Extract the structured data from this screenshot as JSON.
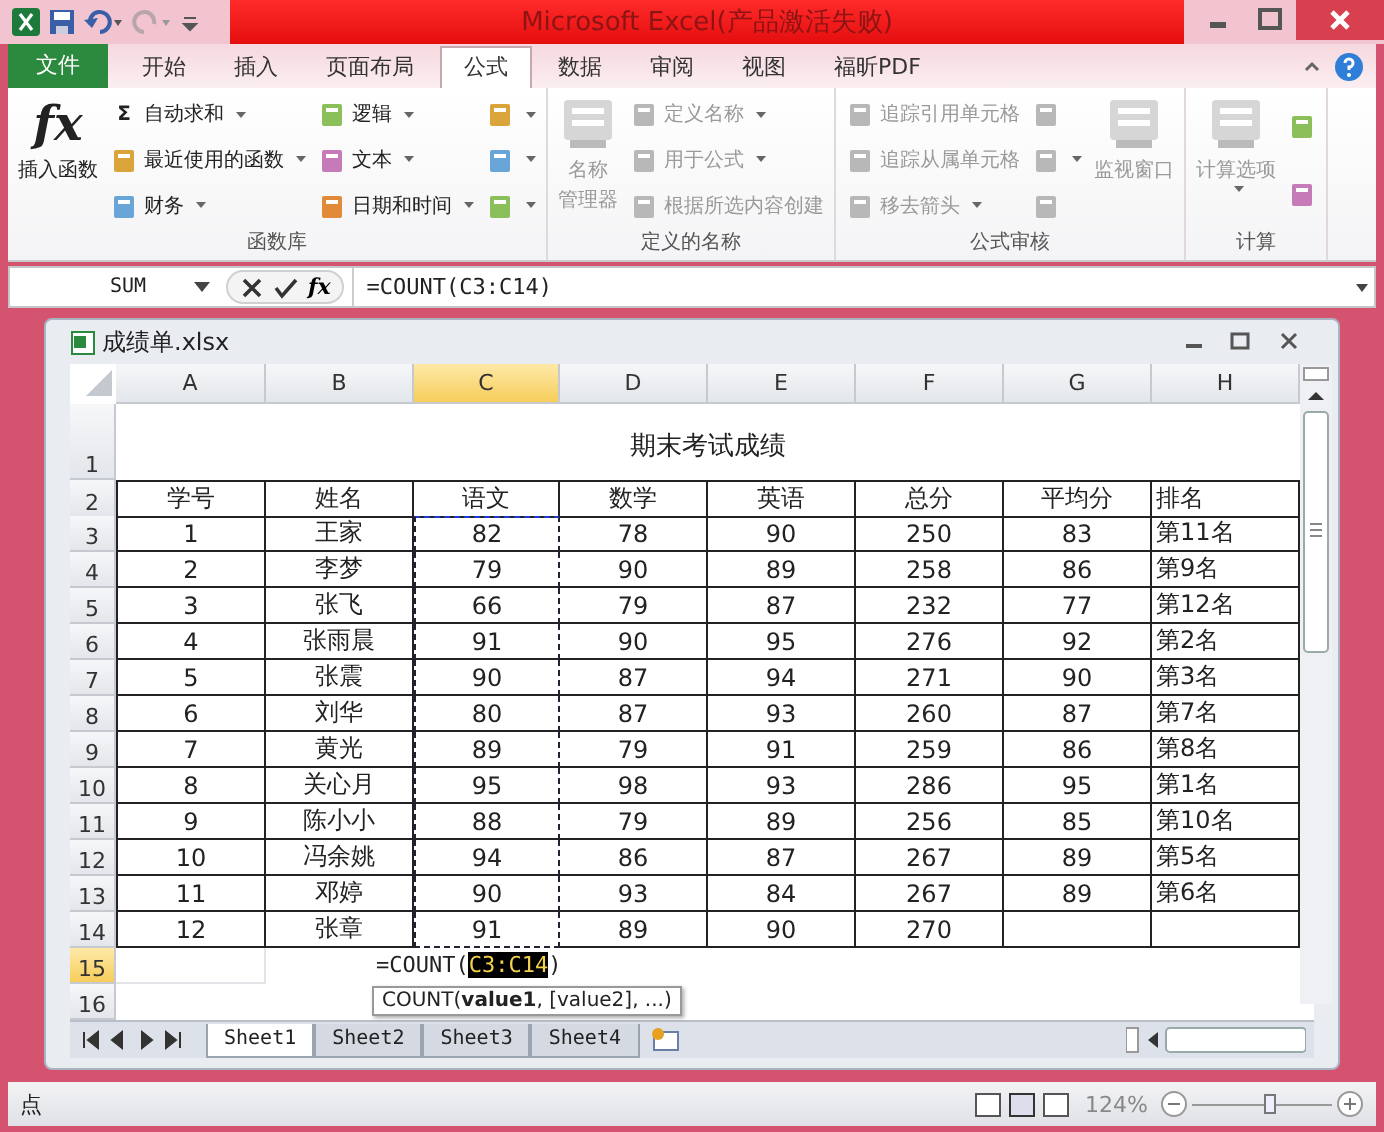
{
  "title_bar": {
    "title": "Microsoft Excel(产品激活失败)"
  },
  "ribbon_tabs": [
    {
      "label": "文件",
      "kind": "file",
      "selected": false
    },
    {
      "label": "开始",
      "kind": "tab",
      "selected": false
    },
    {
      "label": "插入",
      "kind": "tab",
      "selected": false
    },
    {
      "label": "页面布局",
      "kind": "tab",
      "selected": false
    },
    {
      "label": "公式",
      "kind": "tab",
      "selected": true
    },
    {
      "label": "数据",
      "kind": "tab",
      "selected": false
    },
    {
      "label": "审阅",
      "kind": "tab",
      "selected": false
    },
    {
      "label": "视图",
      "kind": "tab",
      "selected": false
    },
    {
      "label": "福昕PDF",
      "kind": "tab",
      "selected": false
    }
  ],
  "ribbon_groups": [
    {
      "label": "函数库",
      "columns": [
        {
          "kind": "large",
          "items": [
            {
              "label": "插入函数",
              "symbol": "fx",
              "dropdown": false,
              "disabled": false
            }
          ]
        },
        {
          "kind": "stack",
          "items": [
            {
              "label": "自动求和",
              "symbol": "Σ",
              "dropdown": true,
              "disabled": false
            },
            {
              "label": "最近使用的函数",
              "dropdown": true,
              "disabled": false
            },
            {
              "label": "财务",
              "dropdown": true,
              "disabled": false
            }
          ]
        },
        {
          "kind": "stack",
          "items": [
            {
              "label": "逻辑",
              "dropdown": true,
              "disabled": false
            },
            {
              "label": "文本",
              "dropdown": true,
              "disabled": false
            },
            {
              "label": "日期和时间",
              "dropdown": true,
              "disabled": false
            }
          ]
        },
        {
          "kind": "stack",
          "items": [
            {
              "dropdown": true,
              "disabled": false
            },
            {
              "dropdown": true,
              "disabled": false
            },
            {
              "dropdown": true,
              "disabled": false
            }
          ]
        }
      ]
    },
    {
      "label": "定义的名称",
      "columns": [
        {
          "kind": "large",
          "items": [
            {
              "label_lines": [
                "名称",
                "管理器"
              ],
              "dropdown": false,
              "disabled": true
            }
          ]
        },
        {
          "kind": "stack",
          "items": [
            {
              "label": "定义名称",
              "dropdown": true,
              "disabled": true
            },
            {
              "label": "用于公式",
              "dropdown": true,
              "disabled": true
            },
            {
              "label": "根据所选内容创建",
              "dropdown": false,
              "disabled": true
            }
          ]
        }
      ]
    },
    {
      "label": "公式审核",
      "columns": [
        {
          "kind": "stack",
          "items": [
            {
              "label": "追踪引用单元格",
              "dropdown": false,
              "disabled": true
            },
            {
              "label": "追踪从属单元格",
              "dropdown": false,
              "disabled": true
            },
            {
              "label": "移去箭头",
              "dropdown": true,
              "disabled": true
            }
          ]
        },
        {
          "kind": "stack",
          "items": [
            {
              "dropdown": false,
              "disabled": true
            },
            {
              "dropdown": true,
              "disabled": true
            },
            {
              "dropdown": false,
              "disabled": true
            }
          ]
        },
        {
          "kind": "large",
          "items": [
            {
              "label": "监视窗口",
              "dropdown": false,
              "disabled": true
            }
          ]
        }
      ]
    },
    {
      "label": "计算",
      "columns": [
        {
          "kind": "large",
          "items": [
            {
              "label": "计算选项",
              "dropdown": true,
              "disabled": true
            }
          ]
        },
        {
          "kind": "stack",
          "items": [
            {
              "dropdown": false,
              "disabled": false
            },
            {
              "dropdown": false,
              "disabled": false
            }
          ]
        }
      ]
    }
  ],
  "formula_bar": {
    "name_box": "SUM",
    "fx_symbol": "fx",
    "formula": "=COUNT(C3:C14)"
  },
  "workbook": {
    "title": "成绩单.xlsx",
    "columns": [
      {
        "label": "A",
        "selected": false
      },
      {
        "label": "B",
        "selected": false
      },
      {
        "label": "C",
        "selected": true
      },
      {
        "label": "D",
        "selected": false
      },
      {
        "label": "E",
        "selected": false
      },
      {
        "label": "F",
        "selected": false
      },
      {
        "label": "G",
        "selected": false
      },
      {
        "label": "H",
        "selected": false
      }
    ],
    "rows": [
      {
        "header": "1",
        "kind": "title",
        "selected": false,
        "title": "期末考试成绩"
      },
      {
        "header": "2",
        "kind": "data",
        "selected": false,
        "in_reference": false,
        "cells": [
          "学号",
          "姓名",
          "语文",
          "数学",
          "英语",
          "总分",
          "平均分",
          "排名"
        ]
      },
      {
        "header": "3",
        "kind": "data",
        "selected": false,
        "in_reference": true,
        "cells": [
          "1",
          "王家",
          "82",
          "78",
          "90",
          "250",
          "83",
          "第11名"
        ]
      },
      {
        "header": "4",
        "kind": "data",
        "selected": false,
        "in_reference": true,
        "cells": [
          "2",
          "李梦",
          "79",
          "90",
          "89",
          "258",
          "86",
          "第9名"
        ]
      },
      {
        "header": "5",
        "kind": "data",
        "selected": false,
        "in_reference": true,
        "cells": [
          "3",
          "张飞",
          "66",
          "79",
          "87",
          "232",
          "77",
          "第12名"
        ]
      },
      {
        "header": "6",
        "kind": "data",
        "selected": false,
        "in_reference": true,
        "cells": [
          "4",
          "张雨晨",
          "91",
          "90",
          "95",
          "276",
          "92",
          "第2名"
        ]
      },
      {
        "header": "7",
        "kind": "data",
        "selected": false,
        "in_reference": true,
        "cells": [
          "5",
          "张震",
          "90",
          "87",
          "94",
          "271",
          "90",
          "第3名"
        ]
      },
      {
        "header": "8",
        "kind": "data",
        "selected": false,
        "in_reference": true,
        "cells": [
          "6",
          "刘华",
          "80",
          "87",
          "93",
          "260",
          "87",
          "第7名"
        ]
      },
      {
        "header": "9",
        "kind": "data",
        "selected": false,
        "in_reference": true,
        "cells": [
          "7",
          "黄光",
          "89",
          "79",
          "91",
          "259",
          "86",
          "第8名"
        ]
      },
      {
        "header": "10",
        "kind": "data",
        "selected": false,
        "in_reference": true,
        "cells": [
          "8",
          "关心月",
          "95",
          "98",
          "93",
          "286",
          "95",
          "第1名"
        ]
      },
      {
        "header": "11",
        "kind": "data",
        "selected": false,
        "in_reference": true,
        "cells": [
          "9",
          "陈小小",
          "88",
          "79",
          "89",
          "256",
          "85",
          "第10名"
        ]
      },
      {
        "header": "12",
        "kind": "data",
        "selected": false,
        "in_reference": true,
        "cells": [
          "10",
          "冯余姚",
          "94",
          "86",
          "87",
          "267",
          "89",
          "第5名"
        ]
      },
      {
        "header": "13",
        "kind": "data",
        "selected": false,
        "in_reference": true,
        "cells": [
          "11",
          "邓婷",
          "90",
          "93",
          "84",
          "267",
          "89",
          "第6名"
        ]
      },
      {
        "header": "14",
        "kind": "data",
        "selected": false,
        "in_reference": true,
        "cells": [
          "12",
          "张章",
          "91",
          "89",
          "90",
          "270"
        ]
      },
      {
        "header": "15",
        "kind": "formula",
        "selected": true,
        "formula_start": "=COUNT(",
        "formula_ref": "C3:C14",
        "formula_end": ")",
        "tooltip": "COUNT(**value1**, [value2], ...)"
      },
      {
        "header": "16",
        "kind": "empty",
        "selected": false
      }
    ],
    "sheets": [
      {
        "label": "Sheet1",
        "selected": true
      },
      {
        "label": "Sheet2",
        "selected": false
      },
      {
        "label": "Sheet3",
        "selected": false
      },
      {
        "label": "Sheet4",
        "selected": false
      }
    ]
  },
  "status_bar": {
    "mode": "点",
    "zoom": "124%",
    "zoom_slider": {
      "level": 0.56
    }
  }
}
